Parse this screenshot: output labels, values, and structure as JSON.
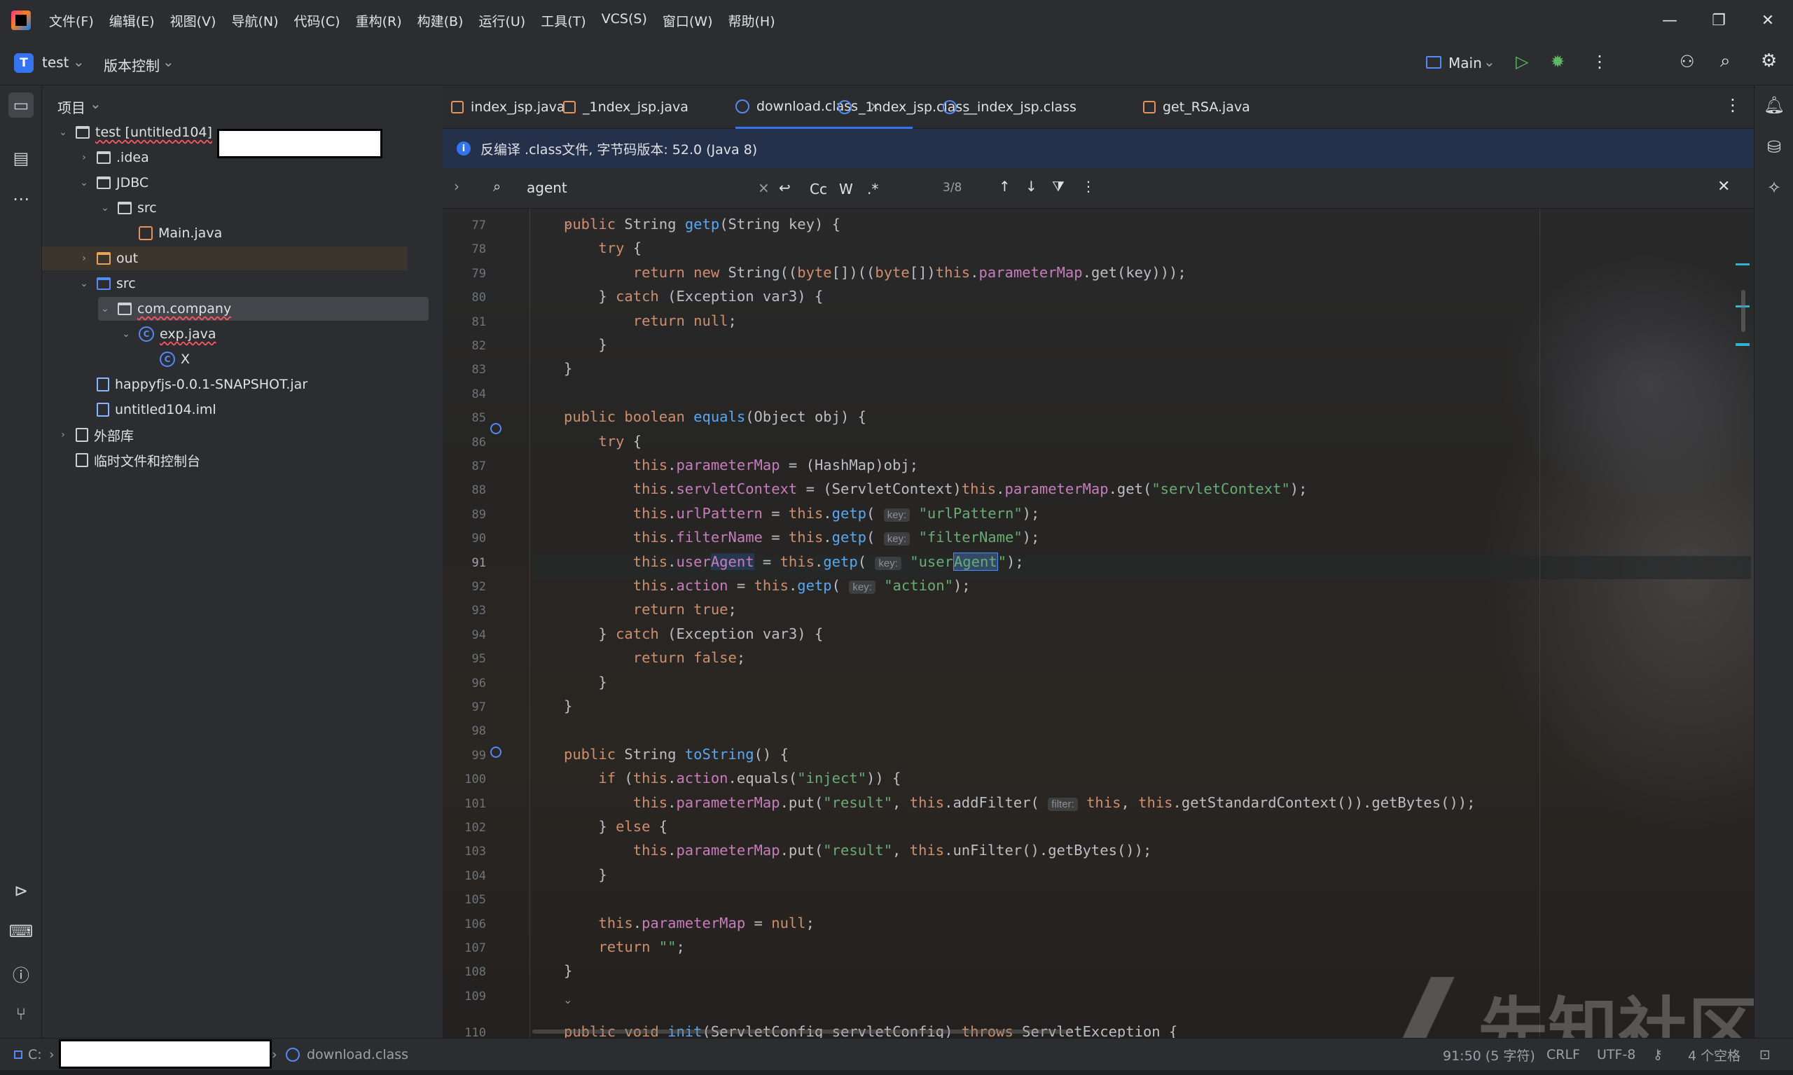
{
  "menubar": {
    "items": [
      "文件(F)",
      "编辑(E)",
      "视图(V)",
      "导航(N)",
      "代码(C)",
      "重构(R)",
      "构建(B)",
      "运行(U)",
      "工具(T)",
      "VCS(S)",
      "窗口(W)",
      "帮助(H)"
    ]
  },
  "toolbar": {
    "project_badge": "T",
    "project_name": "test",
    "vcs_label": "版本控制",
    "run_config": "Main"
  },
  "project_panel": {
    "title": "项目",
    "tree": [
      {
        "label": "test [untitled104]",
        "indent": 0,
        "icon": "module-folder-icon",
        "open": true
      },
      {
        "label": ".idea",
        "indent": 1,
        "icon": "folder-icon",
        "open": false
      },
      {
        "label": "JDBC",
        "indent": 1,
        "icon": "folder-icon",
        "open": true
      },
      {
        "label": "src",
        "indent": 2,
        "icon": "folder-icon",
        "open": true
      },
      {
        "label": "Main.java",
        "indent": 3,
        "icon": "java-file-icon"
      },
      {
        "label": "out",
        "indent": 1,
        "icon": "folder-orange-icon",
        "open": false
      },
      {
        "label": "src",
        "indent": 1,
        "icon": "source-folder-icon",
        "open": true
      },
      {
        "label": "com.company",
        "indent": 2,
        "icon": "package-icon",
        "open": true
      },
      {
        "label": "exp.java",
        "indent": 3,
        "icon": "class-icon",
        "open": true
      },
      {
        "label": "X",
        "indent": 4,
        "icon": "class-icon"
      },
      {
        "label": "happyfjs-0.0.1-SNAPSHOT.jar",
        "indent": 1,
        "icon": "jar-icon"
      },
      {
        "label": "untitled104.iml",
        "indent": 1,
        "icon": "iml-file-icon"
      },
      {
        "label": "外部库",
        "indent": 0,
        "icon": "library-icon",
        "open": false
      },
      {
        "label": "临时文件和控制台",
        "indent": 0,
        "icon": "scratch-icon"
      }
    ]
  },
  "tabs": [
    {
      "label": "index_jsp.java",
      "icon": "java"
    },
    {
      "label": "_1ndex_jsp.java",
      "icon": "java"
    },
    {
      "label": "download.class",
      "icon": "class",
      "active": true
    },
    {
      "label": "_1ndex_jsp.class",
      "icon": "class"
    },
    {
      "label": "__index_jsp.class",
      "icon": "class"
    },
    {
      "label": "get_RSA.java",
      "icon": "java"
    }
  ],
  "infobar": {
    "text": "反编译 .class文件, 字节码版本: 52.0 (Java 8)"
  },
  "find": {
    "query": "agent",
    "match_case": "Cc",
    "words": "W",
    "regex": ".*",
    "count": "3/8"
  },
  "code": {
    "current_line": "91",
    "lines": [
      {
        "n": "77",
        "t": "public String getp(String key) {"
      },
      {
        "n": "78",
        "t": "    try {"
      },
      {
        "n": "79",
        "t": "        return new String((byte[])((byte[])this.parameterMap.get(key)));"
      },
      {
        "n": "80",
        "t": "    } catch (Exception var3) {"
      },
      {
        "n": "81",
        "t": "        return null;"
      },
      {
        "n": "82",
        "t": "    }"
      },
      {
        "n": "83",
        "t": "}"
      },
      {
        "n": "84",
        "t": ""
      },
      {
        "n": "85",
        "t": "public boolean equals(Object obj) {"
      },
      {
        "n": "86",
        "t": "    try {"
      },
      {
        "n": "87",
        "t": "        this.parameterMap = (HashMap)obj;"
      },
      {
        "n": "88",
        "t": "        this.servletContext = (ServletContext)this.parameterMap.get(\"servletContext\");"
      },
      {
        "n": "89",
        "t": "        this.urlPattern = this.getp( key: \"urlPattern\");"
      },
      {
        "n": "90",
        "t": "        this.filterName = this.getp( key: \"filterName\");"
      },
      {
        "n": "91",
        "t": "        this.userAgent = this.getp( key: \"userAgent\");"
      },
      {
        "n": "92",
        "t": "        this.action = this.getp( key: \"action\");"
      },
      {
        "n": "93",
        "t": "        return true;"
      },
      {
        "n": "94",
        "t": "    } catch (Exception var3) {"
      },
      {
        "n": "95",
        "t": "        return false;"
      },
      {
        "n": "96",
        "t": "    }"
      },
      {
        "n": "97",
        "t": "}"
      },
      {
        "n": "98",
        "t": ""
      },
      {
        "n": "99",
        "t": "public String toString() {"
      },
      {
        "n": "100",
        "t": "    if (this.action.equals(\"inject\")) {"
      },
      {
        "n": "101",
        "t": "        this.parameterMap.put(\"result\", this.addFilter( filter: this, this.getStandardContext()).getBytes());"
      },
      {
        "n": "102",
        "t": "    } else {"
      },
      {
        "n": "103",
        "t": "        this.parameterMap.put(\"result\", this.unFilter().getBytes());"
      },
      {
        "n": "104",
        "t": "    }"
      },
      {
        "n": "105",
        "t": ""
      },
      {
        "n": "106",
        "t": "    this.parameterMap = null;"
      },
      {
        "n": "107",
        "t": "    return \"\";"
      },
      {
        "n": "108",
        "t": "}"
      },
      {
        "n": "109",
        "t": ""
      },
      {
        "n": "110",
        "t": "public void init(ServletConfig servletConfig) throws ServletException {"
      }
    ]
  },
  "statusbar": {
    "drive": "C:",
    "file": "download.class",
    "position": "91:50 (5 字符)",
    "line_sep": "CRLF",
    "encoding": "UTF-8",
    "indent": "4 个空格"
  },
  "watermark": {
    "text": "先知社区"
  }
}
